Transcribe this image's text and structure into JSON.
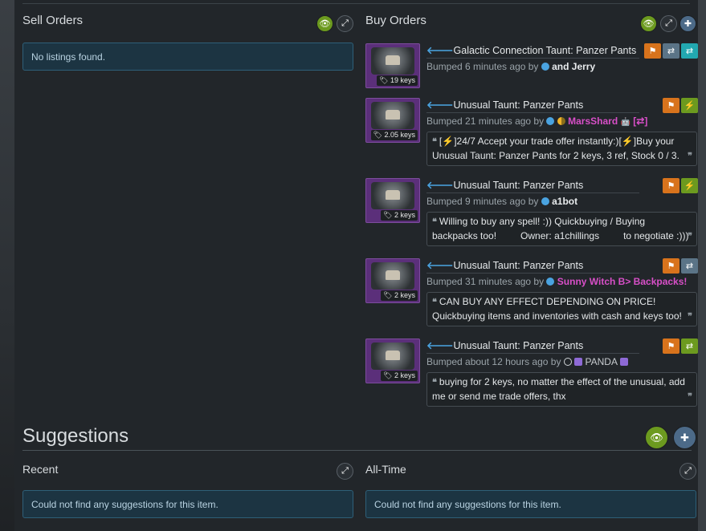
{
  "sell": {
    "title": "Sell Orders",
    "empty": "No listings found."
  },
  "buy": {
    "title": "Buy Orders",
    "listings": [
      {
        "title": "Galactic Connection Taunt: Panzer Pants",
        "price": "19 keys",
        "bumped": "Bumped 6 minutes ago by",
        "user": "and Jerry",
        "comment": ""
      },
      {
        "title": "Unusual Taunt: Panzer Pants",
        "price": "2.05 keys",
        "bumped": "Bumped 21 minutes ago by",
        "user": "MarsShard",
        "comment_a": "[",
        "comment_b": "]24/7 Accept your trade offer instantly:)[",
        "comment_c": "]Buy your Unusual Taunt: Panzer Pants for 2 keys, 3 ref, Stock 0 / 3."
      },
      {
        "title": "Unusual Taunt: Panzer Pants",
        "price": "2 keys",
        "bumped": "Bumped 9 minutes ago by",
        "user": "a1bot",
        "comment": "Willing to buy any spell! :)) Quickbuying / Buying backpacks too!         Owner: a1chillings         to negotiate :)))"
      },
      {
        "title": "Unusual Taunt: Panzer Pants",
        "price": "2 keys",
        "bumped": "Bumped 31 minutes ago by",
        "user": "Sunny Witch B> Backpacks!",
        "comment": "CAN BUY ANY EFFECT DEPENDING ON PRICE! Quickbuying items and inventories with cash and keys too!"
      },
      {
        "title": "Unusual Taunt: Panzer Pants",
        "price": "2 keys",
        "bumped": "Bumped about 12 hours ago by",
        "user": "PANDA",
        "comment": "buying for 2 keys, no matter the effect of the unusual, add me or send me trade offers, thx"
      }
    ]
  },
  "suggestions": {
    "title": "Suggestions",
    "recent_title": "Recent",
    "alltime_title": "All-Time",
    "recent_empty": "Could not find any suggestions for this item.",
    "alltime_empty": "Could not find any suggestions for this item."
  },
  "icons": {
    "eye": "eye-icon",
    "expand": "expand-icon",
    "plus": "plus-icon",
    "flag": "flag-icon",
    "exchange": "exchange-icon",
    "bolt": "lightning-icon",
    "tag": "tag-icon",
    "quote": "quote-icon"
  },
  "colors": {
    "accent_blue": "#4aa3e0",
    "green": "#6c9a1f",
    "orange": "#d8731c",
    "teal": "#22a8b0",
    "pink": "#d84fc8",
    "notice_bg": "#1c3442"
  }
}
